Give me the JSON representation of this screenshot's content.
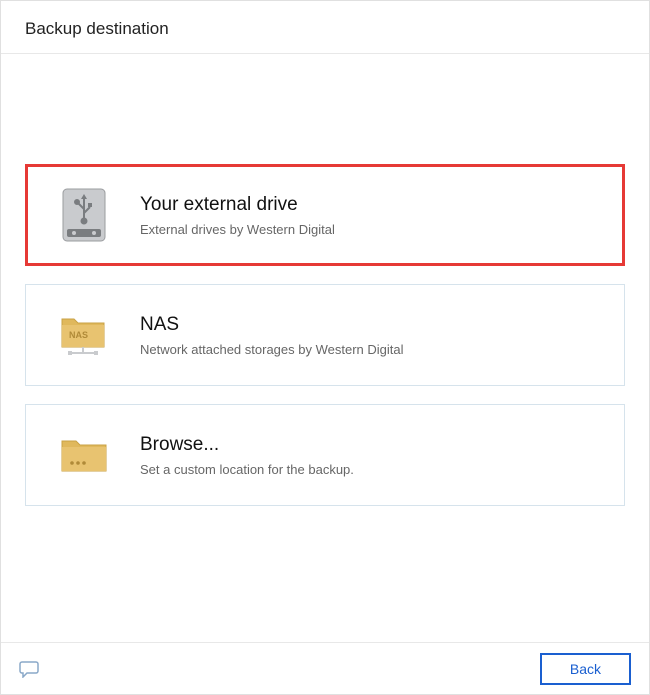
{
  "header": {
    "title": "Backup destination"
  },
  "options": [
    {
      "title": "Your external drive",
      "desc": "External drives by Western Digital"
    },
    {
      "title": "NAS",
      "desc": "Network attached storages by Western Digital"
    },
    {
      "title": "Browse...",
      "desc": "Set a custom location for the backup."
    }
  ],
  "footer": {
    "back_label": "Back"
  }
}
